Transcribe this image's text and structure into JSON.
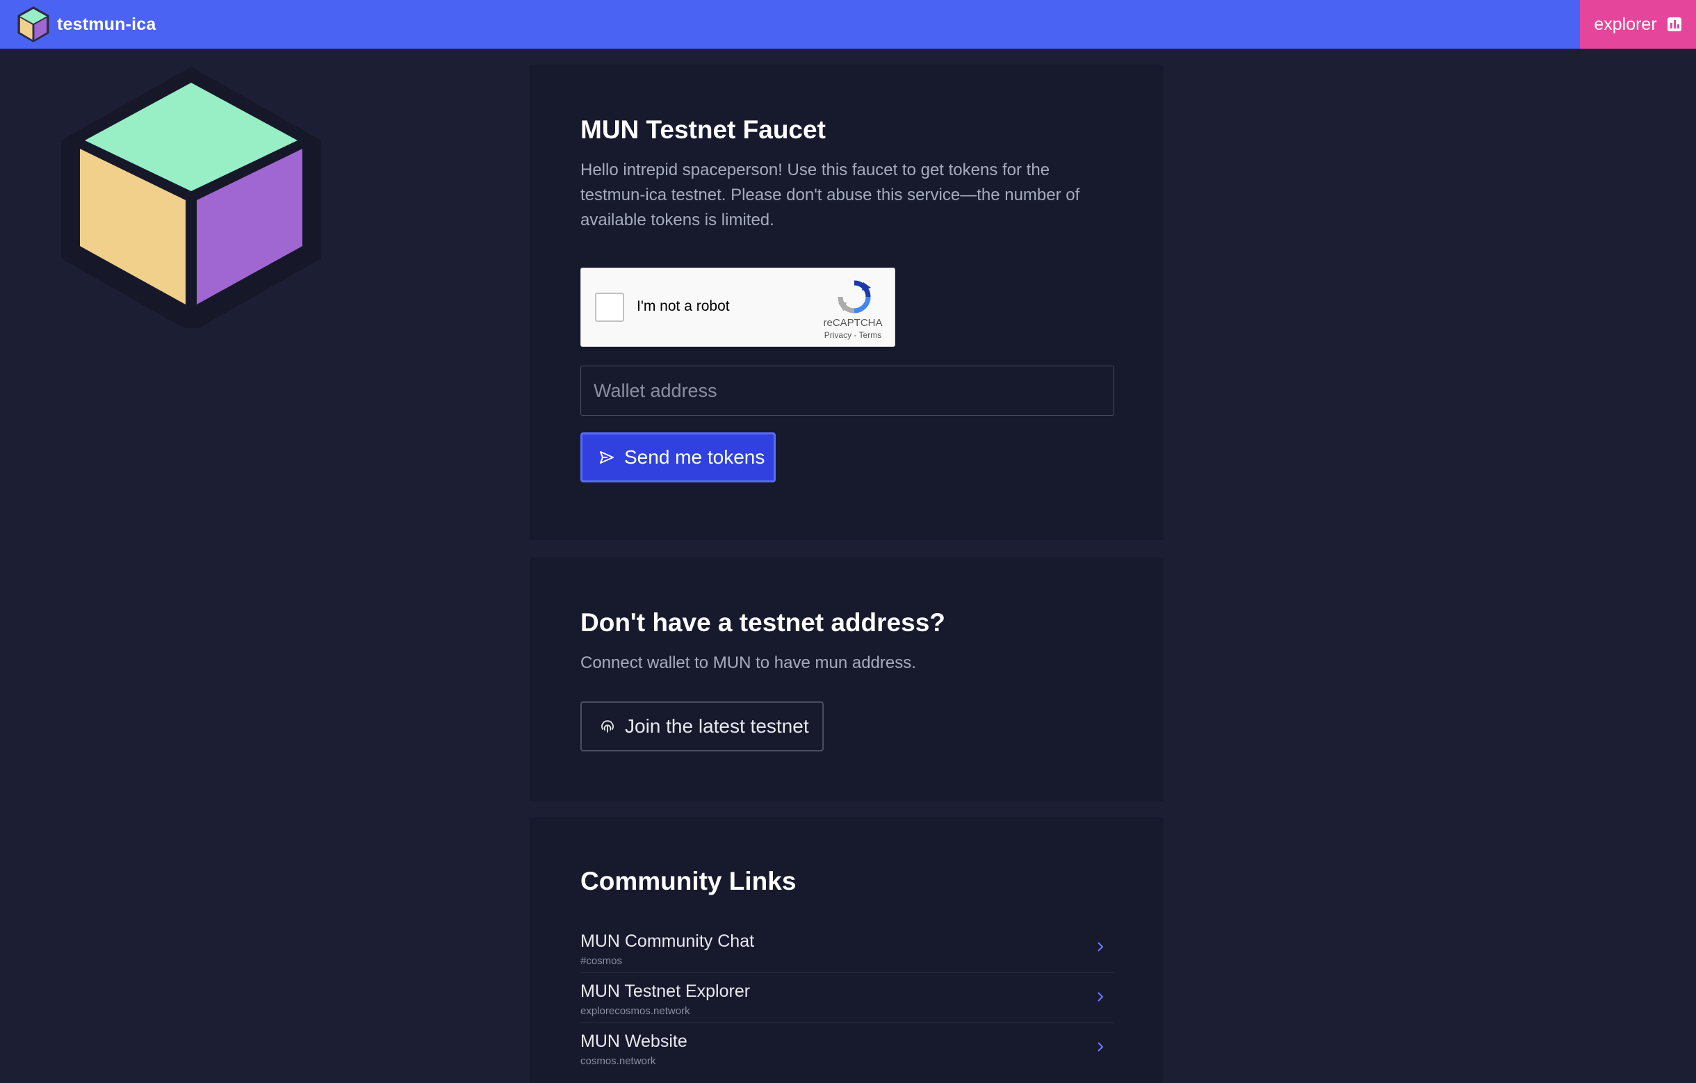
{
  "header": {
    "brand_name": "testmun-ica",
    "brand_icon": "cube-logo-icon",
    "explorer_label": "explorer",
    "explorer_icon": "chart-icon",
    "colors": {
      "bar": "#4b63f3",
      "explorer": "#e5469c"
    }
  },
  "hero": {
    "icon": "cube-icon",
    "colors": {
      "top": "#98efc6",
      "left": "#f0d08b",
      "right": "#a066d1"
    }
  },
  "faucet": {
    "title": "MUN Testnet Faucet",
    "description": "Hello intrepid spaceperson! Use this faucet to get tokens for the testmun-ica testnet. Please don't abuse this service—the number of available tokens is limited.",
    "captcha": {
      "label": "I'm not a robot",
      "brand": "reCAPTCHA",
      "links": "Privacy - Terms",
      "icon": "recaptcha-icon"
    },
    "wallet_placeholder": "Wallet address",
    "wallet_value": "",
    "send_label": "Send me tokens",
    "send_icon": "send-icon"
  },
  "join": {
    "title": "Don't have a testnet address?",
    "description": "Connect wallet to MUN to have mun address.",
    "button_label": "Join the latest testnet",
    "button_icon": "fingerprint-icon"
  },
  "community": {
    "title": "Community Links",
    "links": [
      {
        "title": "MUN Community Chat",
        "subtitle": "#cosmos",
        "icon": "chevron-right-icon"
      },
      {
        "title": "MUN Testnet Explorer",
        "subtitle": "explorecosmos.network",
        "icon": "chevron-right-icon"
      },
      {
        "title": "MUN Website",
        "subtitle": "cosmos.network",
        "icon": "chevron-right-icon"
      }
    ]
  }
}
